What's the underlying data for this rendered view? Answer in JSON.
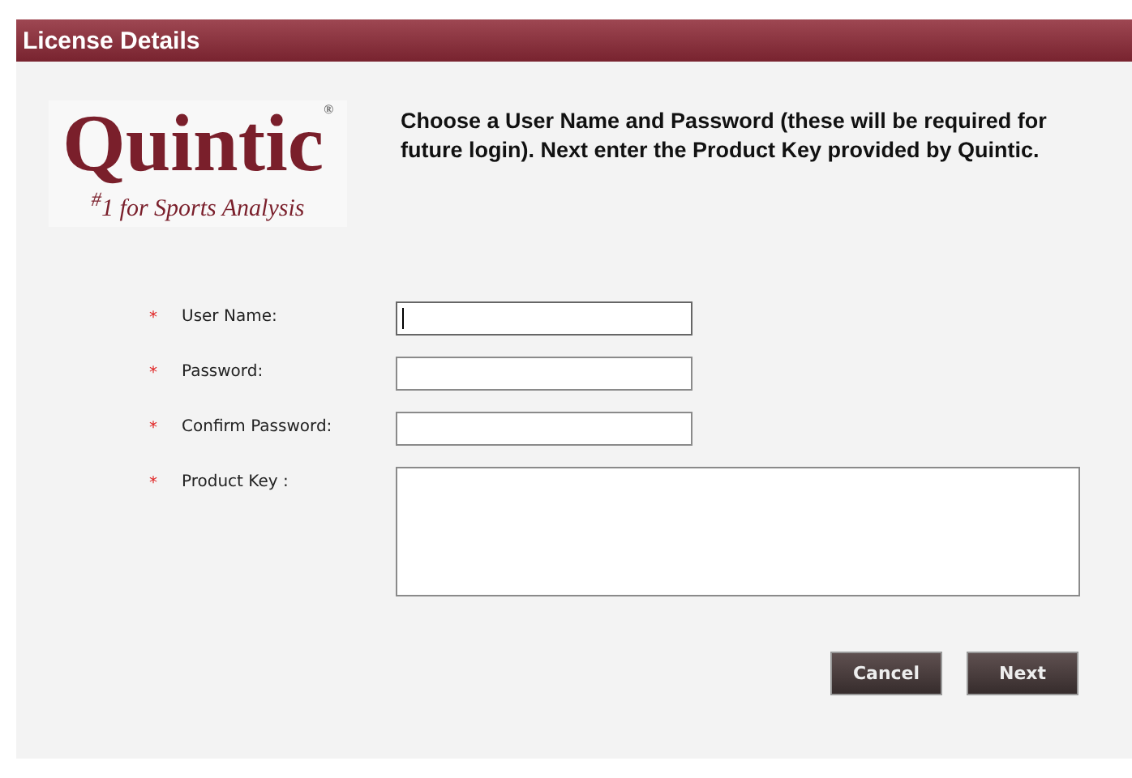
{
  "header": {
    "title": "License Details"
  },
  "logo": {
    "name": "Quintic",
    "mark": "®",
    "tagline": "$^{#}$1 for Sports Analysis"
  },
  "intro": "Choose a User Name and Password (these will be required for future login). Next enter the Product Key provided by Quintic.",
  "fields": [
    {
      "label": "User Name:",
      "required_mark": "*",
      "kind": "text",
      "focused": true
    },
    {
      "label": "Password:",
      "required_mark": "*",
      "kind": "text",
      "focused": false
    },
    {
      "label": "Confirm Password:",
      "required_mark": "*",
      "kind": "text",
      "focused": false
    },
    {
      "label": "Product Key :",
      "required_mark": "*",
      "kind": "multiline",
      "focused": false
    }
  ],
  "buttons": [
    {
      "label": "Cancel"
    },
    {
      "label": "Next"
    }
  ]
}
